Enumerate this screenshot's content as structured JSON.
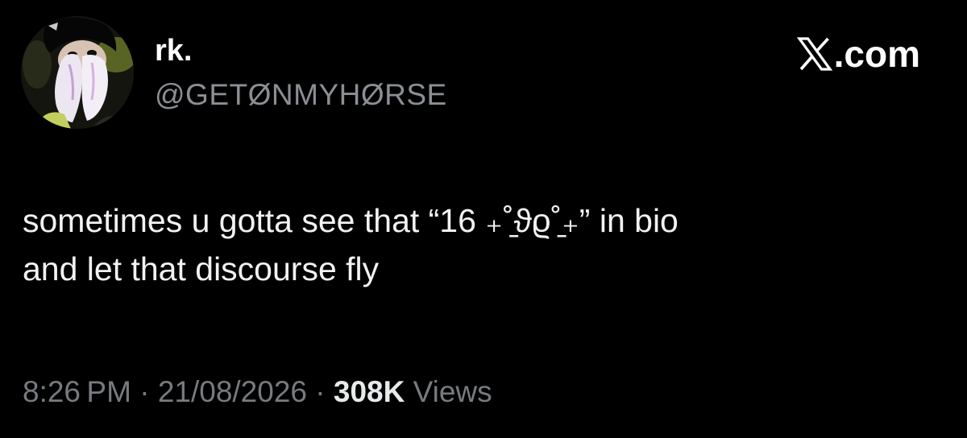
{
  "tweet": {
    "author": {
      "display_name": "rk.",
      "handle": "@GETØNMYHØRSE",
      "avatar_icon": "profile-photo"
    },
    "brand": {
      "logo_icon": "x-logo-icon",
      "suffix": ".com"
    },
    "text_lines": [
      "sometimes u gotta see that “16 ₊˚̱ϑϱ˚̱₊” in bio",
      "and let that discourse fly"
    ],
    "meta": {
      "time": "8:26 PM",
      "sep1": " · ",
      "date": "21/08/2026",
      "sep2": " · ",
      "views_count": "308K",
      "views_label": " Views"
    },
    "colors": {
      "background": "#000000",
      "primary_text": "#e7e9ea",
      "secondary_text": "#8b8f94"
    }
  }
}
